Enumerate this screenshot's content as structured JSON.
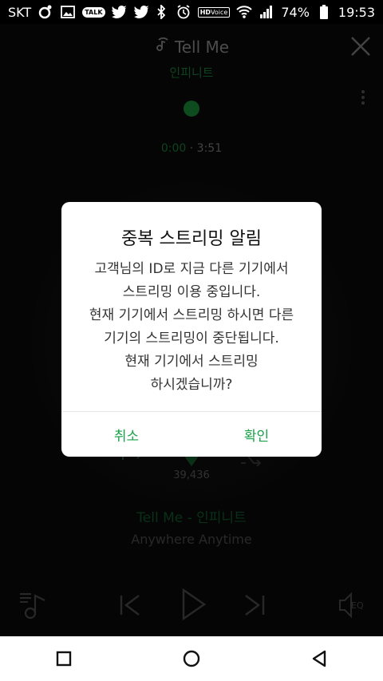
{
  "status_bar": {
    "carrier": "SKT",
    "left_icons": [
      "melon-icon",
      "gallery-icon",
      "kakaotalk-icon",
      "twitter-icon",
      "twitter-icon"
    ],
    "talk_label": "TALK",
    "hd_label_top": "HD",
    "hd_label_bottom": "Voice",
    "battery_percent": "74%",
    "time": "19:53"
  },
  "player": {
    "song_title": "Tell Me",
    "artist": "인피니트",
    "time_current": "0:00",
    "time_separator": "·",
    "time_total": "3:51",
    "like_count": "39,436",
    "song_line": "Tell Me - 인피니트",
    "album": "Anywhere Anytime",
    "eq_label": "EQ"
  },
  "dialog": {
    "title": "중복 스트리밍 알림",
    "message_lines": [
      "고객님의 ID로 지금 다른 기기에서",
      "스트리밍 이용 중입니다.",
      "현재 기기에서 스트리밍 하시면 다른",
      "기기의 스트리밍이 중단됩니다.",
      "현재 기기에서 스트리밍",
      "하시겠습니까?"
    ],
    "cancel_label": "취소",
    "confirm_label": "확인"
  },
  "colors": {
    "accent_green": "#1aa24a",
    "dim_green": "#1a7a3a"
  }
}
